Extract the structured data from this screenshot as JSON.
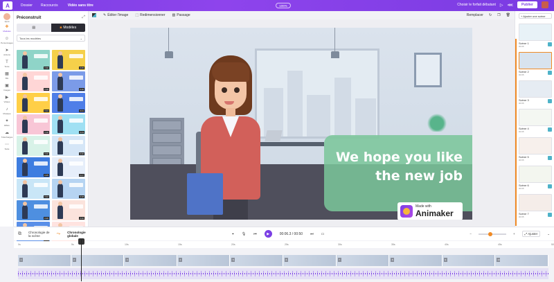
{
  "topbar": {
    "logo": "A",
    "menu": [
      "Dossier",
      "Raccourcis"
    ],
    "title": "Vidéo sans titre",
    "zoom": "106%",
    "choose_tab": "Choisir le forfait débutant",
    "publish_label": "Publier"
  },
  "rail": {
    "items": [
      {
        "label": "Ajout",
        "icon": "avatar-icon"
      },
      {
        "label": "Modèles",
        "icon": "templates-icon"
      },
      {
        "label": "Personnages",
        "icon": "character-icon"
      },
      {
        "label": "Actions",
        "icon": "action-icon"
      },
      {
        "label": "Texte",
        "icon": "text-icon"
      },
      {
        "label": "BG",
        "icon": "background-icon"
      },
      {
        "label": "Images",
        "icon": "image-icon"
      },
      {
        "label": "Vidéos",
        "icon": "video-icon"
      },
      {
        "label": "Musique",
        "icon": "music-icon"
      },
      {
        "label": "Effets",
        "icon": "effects-icon"
      },
      {
        "label": "Téléchargés",
        "icon": "upload-icon"
      },
      {
        "label": "Suite",
        "icon": "more-icon"
      }
    ]
  },
  "left_panel": {
    "title": "Préconstruit",
    "segments": [
      "",
      "Modèles"
    ],
    "filter": "Tous les modèles",
    "thumbs": [
      {
        "bg": "#8fd4c8",
        "dur": "0:30"
      },
      {
        "bg": "#f5d04a",
        "dur": "0:25"
      },
      {
        "bg": "#ffd6d6",
        "dur": "0:28"
      },
      {
        "bg": "#7b9be8",
        "dur": "0:20"
      },
      {
        "bg": "#ffcf47",
        "dur": "0:24"
      },
      {
        "bg": "#4f7ee8",
        "dur": "0:21"
      },
      {
        "bg": "#f8c6d6",
        "dur": "0:18"
      },
      {
        "bg": "#9fe0f3",
        "dur": "0:23"
      },
      {
        "bg": "#d8f2e8",
        "dur": "0:20"
      },
      {
        "bg": "#d5e6f7",
        "dur": "0:20"
      },
      {
        "bg": "#3e7de0",
        "dur": "0:25"
      },
      {
        "bg": "#e6eefa",
        "dur": "0:27"
      },
      {
        "bg": "#c9e6f7",
        "dur": "0:22"
      },
      {
        "bg": "#b6d4f2",
        "dur": "0:18"
      },
      {
        "bg": "#4e8fe0",
        "dur": "0:26"
      },
      {
        "bg": "#fbe3dc",
        "dur": "0:20"
      },
      {
        "bg": "#5a8fe8",
        "dur": "0:15"
      },
      {
        "bg": "#ffe3e0",
        "dur": "0:12"
      }
    ]
  },
  "canvas_toolbar": {
    "edit_image": "Éditer l'image",
    "resize": "Redimensionner",
    "transition": "Passage",
    "replace": "Remplacer"
  },
  "stage": {
    "headline_line1": "We hope you like",
    "headline_line2": "the new job",
    "watermark_small": "Made with",
    "watermark_big": "Animaker"
  },
  "scenes_panel": {
    "add_label": "+ Ajouter une scène",
    "scenes": [
      {
        "label": "Scène 1",
        "dur": "00:05",
        "bg": "#e8f2f7"
      },
      {
        "label": "Scène 2",
        "dur": "00:05",
        "bg": "#d8e3ee"
      },
      {
        "label": "Scène 3",
        "dur": "00:05",
        "bg": "#e6ecf3"
      },
      {
        "label": "Scène 4",
        "dur": "00:05",
        "bg": "#f4f7f2"
      },
      {
        "label": "Scène 5",
        "dur": "00:05",
        "bg": "#f7f0ec"
      },
      {
        "label": "Scène 6",
        "dur": "00:05",
        "bg": "#f3f6ef"
      },
      {
        "label": "Scène 7",
        "dur": "00:05",
        "bg": "#f5ede9"
      }
    ]
  },
  "player": {
    "tab1_top": "Chronologie de",
    "tab1_bottom": "la scène",
    "tab2_top": "Chronologie",
    "tab2_bottom": "globale",
    "time": "00:06.3 / 00:50",
    "fit_label": "Ajuster"
  },
  "timeline": {
    "ticks": [
      "0s",
      "5s",
      "10s",
      "15s",
      "20s",
      "25s",
      "30s",
      "35s",
      "40s",
      "45s",
      "50s"
    ],
    "clips": [
      "1",
      "2",
      "3",
      "4",
      "5",
      "6",
      "7",
      "8",
      "9",
      "10"
    ]
  },
  "colors": {
    "accent": "#7b3fe4",
    "highlight": "#f08a24",
    "banner": "#7ac69a"
  }
}
